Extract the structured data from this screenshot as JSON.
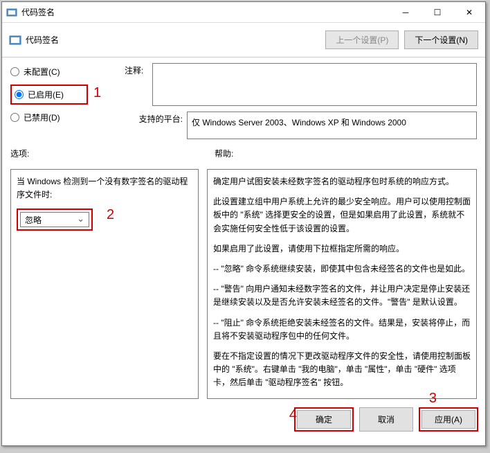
{
  "window": {
    "title": "代码签名"
  },
  "toolbar": {
    "title": "代码签名",
    "prev": "上一个设置(P)",
    "next": "下一个设置(N)"
  },
  "radios": {
    "unconfigured": "未配置(C)",
    "enabled": "已启用(E)",
    "disabled": "已禁用(D)"
  },
  "labels": {
    "comments": "注释:",
    "platforms": "支持的平台:",
    "options": "选项:",
    "help": "帮助:"
  },
  "platforms_text": "仅 Windows Server 2003、Windows XP 和 Windows 2000",
  "option_desc": "当 Windows 检测到一个没有数字签名的驱动程序文件时:",
  "select_value": "忽略",
  "help_text": {
    "p1": "确定用户试图安装未经数字签名的驱动程序包时系统的响应方式。",
    "p2": "此设置建立组中用户系统上允许的最少安全响应。用户可以使用控制面板中的 \"系统\" 选择更安全的设置，但是如果启用了此设置，系统就不会实施任何安全性低于该设置的设置。",
    "p3": "如果启用了此设置，请使用下拉框指定所需的响应。",
    "p4": "-- \"忽略\" 命令系统继续安装，即使其中包含未经签名的文件也是如此。",
    "p5": "-- \"警告\" 向用户通知未经数字签名的文件，并让用户决定是停止安装还是继续安装以及是否允许安装未经签名的文件。\"警告\" 是默认设置。",
    "p6": "-- \"阻止\" 命令系统拒绝安装未经签名的文件。结果是，安装将停止，而且将不安装驱动程序包中的任何文件。",
    "p7": "要在不指定设置的情况下更改驱动程序文件的安全性，请使用控制面板中的 \"系统\"。右键单击 \"我的电脑\"，单击 \"属性\"，单击 \"硬件\" 选项卡，然后单击 \"驱动程序签名\" 按钮。"
  },
  "buttons": {
    "ok": "确定",
    "cancel": "取消",
    "apply": "应用(A)"
  },
  "annots": {
    "1": "1",
    "2": "2",
    "3": "3",
    "4": "4"
  }
}
